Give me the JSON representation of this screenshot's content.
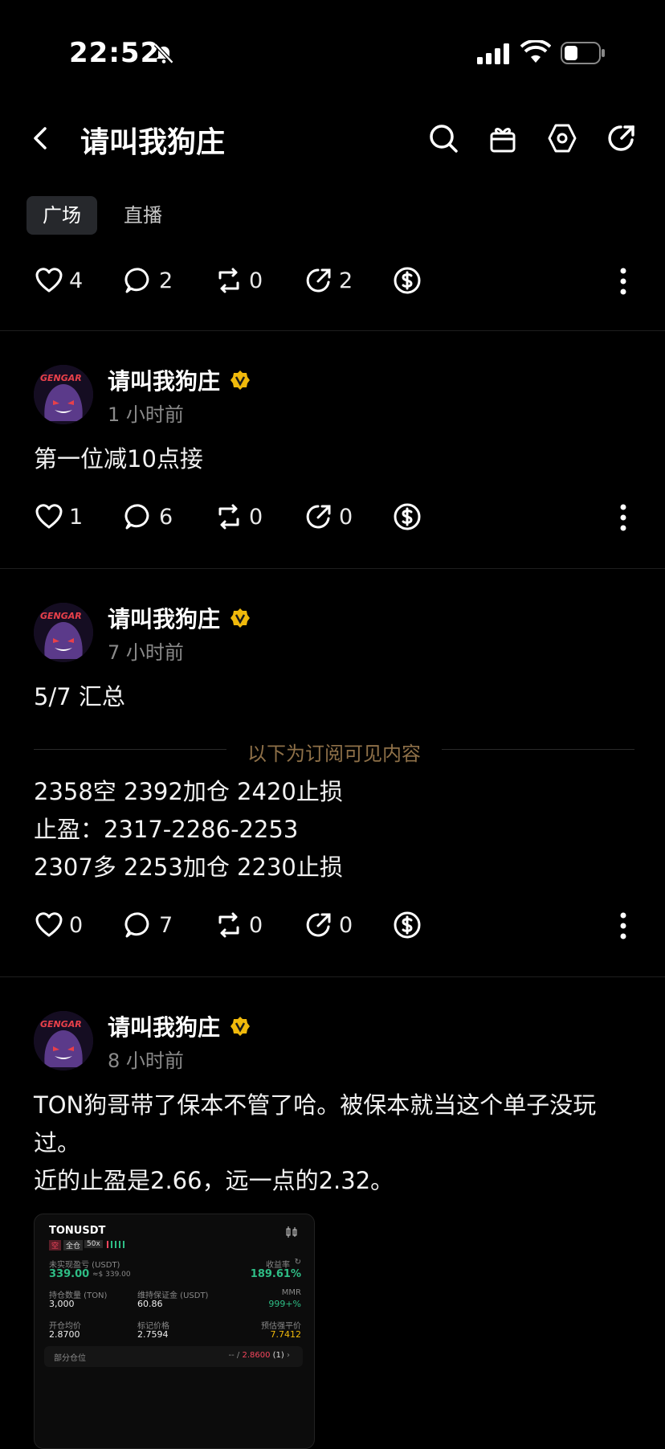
{
  "status_bar": {
    "time": "22:52"
  },
  "header": {
    "title": "请叫我狗庄"
  },
  "tabs": [
    {
      "label": "广场",
      "active": true
    },
    {
      "label": "直播",
      "active": false
    }
  ],
  "top_actions": {
    "likes": "4",
    "comments": "2",
    "reposts": "0",
    "shares": "2"
  },
  "posts": [
    {
      "author": "请叫我狗庄",
      "time": "1 小时前",
      "lines": [
        "第一位减10点接"
      ],
      "likes": "1",
      "comments": "6",
      "reposts": "0",
      "shares": "0"
    },
    {
      "author": "请叫我狗庄",
      "time": "7 小时前",
      "lines": [
        "5/7 汇总"
      ],
      "subscribe_divider": "以下为订阅可见内容",
      "sub_lines": [
        "2358空 2392加仓  2420止损",
        "止盈：2317-2286-2253",
        "2307多 2253加仓 2230止损"
      ],
      "likes": "0",
      "comments": "7",
      "reposts": "0",
      "shares": "0"
    },
    {
      "author": "请叫我狗庄",
      "time": "8 小时前",
      "lines": [
        "TON狗哥带了保本不管了哈。被保本就当这个单子没玩",
        "过。",
        "近的止盈是2.66，远一点的2.32。"
      ],
      "card": {
        "symbol": "TONUSDT",
        "tag_short": "空",
        "tag_cross": "全仓",
        "tag_leverage": "50x",
        "pnl_label": "未实现盈亏 (USDT)",
        "pnl_value": "339.00",
        "pnl_approx": "≈$ 339.00",
        "roe_label": "收益率",
        "roe_value": "189.61%",
        "qty_label": "持仓数量 (TON)",
        "qty_value": "3,000",
        "margin_label": "维持保证金 (USDT)",
        "margin_value": "60.86",
        "mmr_label": "MMR",
        "mmr_value": "999+%",
        "entry_label": "开仓均价",
        "entry_value": "2.8700",
        "mark_label": "标记价格",
        "mark_value": "2.7594",
        "liq_label": "预估强平价",
        "liq_value": "7.7412",
        "partial_label": "部分仓位",
        "partial_prefix": "-- /",
        "partial_price": "2.8600",
        "partial_count": "(1)"
      }
    }
  ],
  "colors": {
    "badge": "#f0b90b",
    "green": "#2ebd85",
    "red": "#f6465d",
    "muted": "#8a8a8a",
    "gold_text": "#8e7048"
  }
}
